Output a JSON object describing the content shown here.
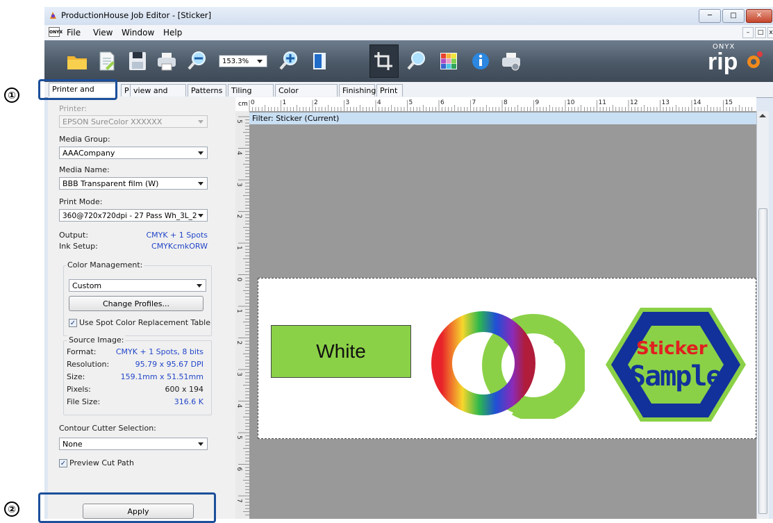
{
  "window": {
    "title": "ProductionHouse Job Editor - [Sticker]"
  },
  "menu": {
    "file": "File",
    "view": "View",
    "window": "Window",
    "help": "Help",
    "app_icon_text": "ONYX"
  },
  "toolbar": {
    "zoom_value": "153.3%",
    "logo_top": "ONYX",
    "logo_main": "rip"
  },
  "tabs": [
    {
      "label": "Printer and Media"
    },
    {
      "label": "P"
    },
    {
      "label": "view and Size"
    },
    {
      "label": "Patterns"
    },
    {
      "label": "Tiling Setup"
    },
    {
      "label": "Color Correction"
    },
    {
      "label": "Finishing"
    },
    {
      "label": "Print"
    }
  ],
  "panel": {
    "printer_label": "Printer:",
    "printer_value": "EPSON SureColor XXXXXX",
    "media_group_label": "Media Group:",
    "media_group_value": "AAACompany",
    "media_name_label": "Media Name:",
    "media_name_value": "BBB Transparent film (W)",
    "print_mode_label": "Print Mode:",
    "print_mode_value": "360@720x720dpi - 27 Pass Wh_3L_2",
    "output_label": "Output:",
    "output_value": "CMYK + 1 Spots",
    "ink_setup_label": "Ink Setup:",
    "ink_setup_value": "CMYKcmkORW",
    "color_mgmt_label": "Color Management:",
    "color_mgmt_value": "Custom",
    "change_profiles_label": "Change Profiles...",
    "spot_color_label": "Use Spot Color Replacement Table",
    "source_image_label": "Source Image:",
    "format_label": "Format:",
    "format_value": "CMYK + 1 Spots, 8 bits",
    "resolution_label": "Resolution:",
    "resolution_value": "95.79 x 95.67 DPI",
    "size_label": "Size:",
    "size_value": "159.1mm x 51.51mm",
    "pixels_label": "Pixels:",
    "pixels_value": "600 x 194",
    "file_size_label": "File Size:",
    "file_size_value": "316.6 K",
    "contour_label": "Contour Cutter Selection:",
    "contour_value": "None",
    "preview_cut_label": "Preview Cut Path",
    "apply_label": "Apply"
  },
  "ruler": {
    "unit": "cm",
    "top_ticks": [
      "0",
      "1",
      "2",
      "3",
      "4",
      "5",
      "6",
      "7",
      "8",
      "9",
      "10",
      "11",
      "12",
      "13",
      "14",
      "15"
    ],
    "left_ticks": [
      "5",
      "4",
      "3",
      "2",
      "1",
      "0",
      "1",
      "2",
      "3",
      "4",
      "5",
      "6",
      "7"
    ]
  },
  "canvas": {
    "filter_label": "Filter: Sticker (Current)",
    "white_box_text": "White",
    "sticker_line1": "Sticker",
    "sticker_line2": "Sample"
  },
  "callouts": {
    "one": "①",
    "two": "②"
  },
  "colors": {
    "green": "#8bd147",
    "blue": "#12319a",
    "red": "#e02020",
    "selection": "#1b4f9b"
  }
}
